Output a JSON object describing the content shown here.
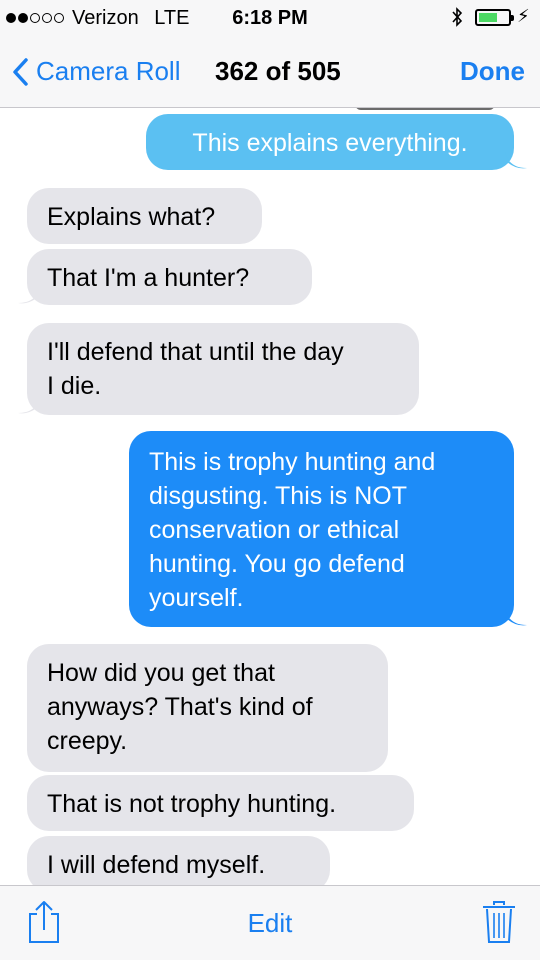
{
  "status_bar": {
    "carrier": "Verizon",
    "network": "LTE",
    "time": "6:18 PM",
    "signal_bars_full": 2,
    "signal_bars_total": 5,
    "battery_level": 0.55,
    "bluetooth_icon": "bluetooth-icon",
    "charging_icon": "bolt-icon"
  },
  "nav": {
    "back_label": "Camera Roll",
    "counter": "362 of 505",
    "done_label": "Done"
  },
  "messages": [
    {
      "side": "out",
      "text": "This explains everything."
    },
    {
      "side": "in",
      "text": "Explains what?"
    },
    {
      "side": "in",
      "text": "That I'm a hunter?"
    },
    {
      "side": "in",
      "line1": "I'll defend that until the day",
      "line2": "I die."
    },
    {
      "side": "out",
      "lines": [
        "This is trophy hunting and",
        "disgusting. This is NOT",
        "conservation or ethical",
        "hunting. You go defend",
        "yourself."
      ]
    },
    {
      "side": "in",
      "lines": [
        "How did you get that",
        "anyways? That's kind of",
        "creepy."
      ]
    },
    {
      "side": "in",
      "text": "That is not trophy hunting."
    },
    {
      "side": "in",
      "text": "I will defend myself."
    }
  ],
  "toolbar": {
    "share_icon": "share-icon",
    "edit_label": "Edit",
    "trash_icon": "trash-icon"
  },
  "colors": {
    "accent": "#1a7ff0",
    "incoming_bubble": "#e5e5ea",
    "outgoing_light": "#5bc0f2",
    "outgoing_blue": "#1d8cf8"
  }
}
